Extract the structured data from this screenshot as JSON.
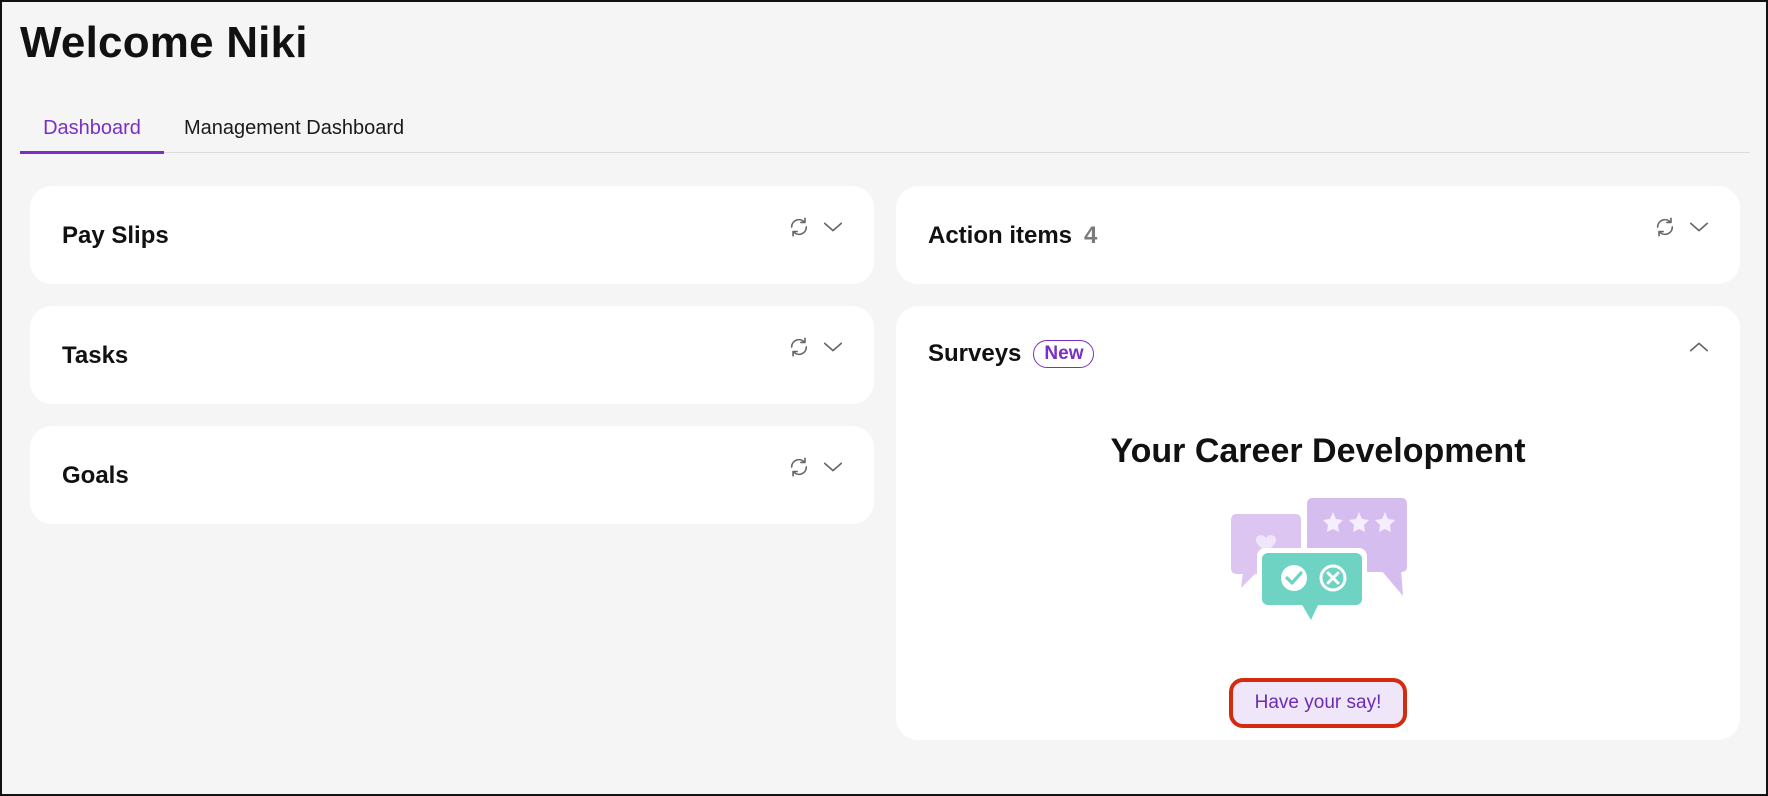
{
  "header": {
    "title": "Welcome Niki"
  },
  "tabs": [
    {
      "label": "Dashboard",
      "active": true
    },
    {
      "label": "Management Dashboard",
      "active": false
    }
  ],
  "cards": {
    "pay_slips": {
      "title": "Pay Slips"
    },
    "tasks": {
      "title": "Tasks"
    },
    "goals": {
      "title": "Goals"
    },
    "action_items": {
      "title": "Action items",
      "count": "4"
    },
    "surveys": {
      "title": "Surveys",
      "badge": "New",
      "survey_title": "Your Career Development",
      "cta_label": "Have your say!"
    }
  },
  "icons": {
    "refresh": "refresh-icon",
    "chevron_down": "chevron-down-icon",
    "chevron_up": "chevron-up-icon"
  },
  "colors": {
    "accent": "#7a2fc6",
    "background": "#f5f5f5",
    "card": "#ffffff",
    "highlight": "#d42a0e",
    "illustration_lilac": "#dcc6f1",
    "illustration_teal": "#6fd3c4"
  }
}
